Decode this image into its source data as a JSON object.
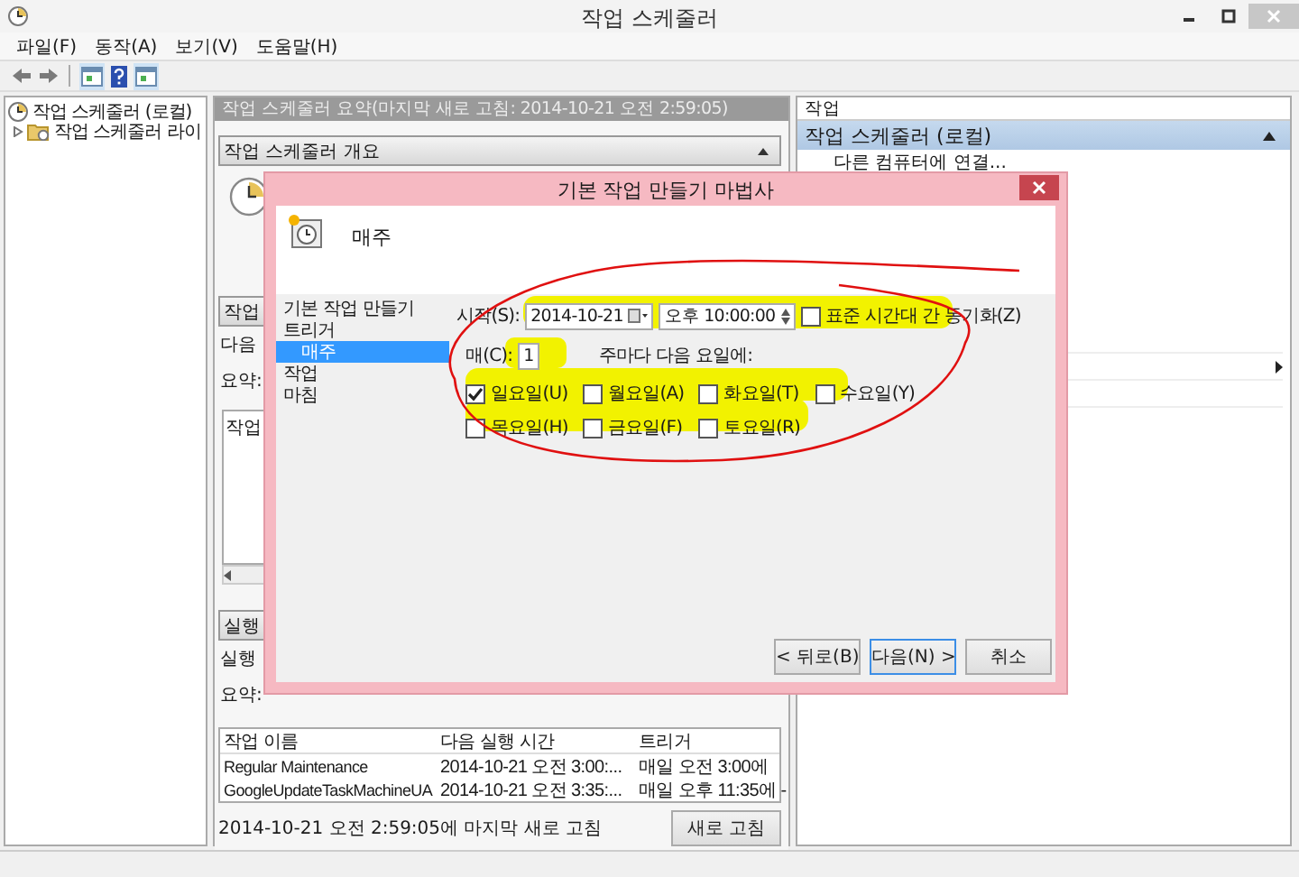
{
  "window": {
    "title": "작업 스케줄러"
  },
  "menu": [
    "파일(F)",
    "동작(A)",
    "보기(V)",
    "도움말(H)"
  ],
  "tree": [
    {
      "label": "작업 스케줄러 (로컬)",
      "children": [
        {
          "label": "작업 스케줄러 라이",
          "expanded": false
        }
      ]
    }
  ],
  "summary": {
    "header": "작업 스케줄러 요약(마지막 새로 고침: 2014-10-21 오전 2:59:05)",
    "overview": {
      "title": "작업 스케줄러 개요",
      "expanded": true
    },
    "status_section": {
      "title": "작업",
      "lines": [
        "다음",
        "요약:"
      ],
      "list_header": "작업"
    },
    "running_section": {
      "title": "실행",
      "lines": [
        "실행",
        "요약:"
      ]
    },
    "table": {
      "columns": [
        "작업 이름",
        "다음 실행 시간",
        "트리거"
      ],
      "rows": [
        [
          "Regular Maintenance",
          "2014-10-21 오전 3:00:...",
          "매일 오전 3:00에"
        ],
        [
          "GoogleUpdateTaskMachineUA",
          "2014-10-21 오전 3:35:...",
          "매일 오후 11:35에 -"
        ]
      ]
    },
    "refreshed": "2014-10-21 오전 2:59:05에 마지막 새로 고침",
    "refresh_button": "새로 고침"
  },
  "actions": {
    "header": "작업",
    "group": {
      "title": "작업 스케줄러 (로컬)",
      "expanded": true,
      "items": [
        "다른 컴퓨터에 연결..."
      ]
    }
  },
  "dialog": {
    "title": "기본 작업 만들기 마법사",
    "step_title": "매주",
    "steps": [
      {
        "label": "기본 작업 만들기",
        "selected": false
      },
      {
        "label": "트리거",
        "selected": false,
        "children": [
          {
            "label": "매주",
            "selected": true
          }
        ]
      },
      {
        "label": "작업",
        "selected": false
      },
      {
        "label": "마침",
        "selected": false
      }
    ],
    "start_label": "시작(S):",
    "date": "2014-10-21",
    "time": "오후 10:00:00",
    "sync": {
      "label": "표준 시간대 간 동기화(Z)",
      "checked": false
    },
    "recur_label": "매(C):",
    "recur_value": "1",
    "weeks_label": "주마다 다음 요일에:",
    "days": [
      {
        "label": "일요일(U)",
        "checked": true
      },
      {
        "label": "월요일(A)",
        "checked": false
      },
      {
        "label": "화요일(T)",
        "checked": false
      },
      {
        "label": "수요일(Y)",
        "checked": false
      },
      {
        "label": "목요일(H)",
        "checked": false
      },
      {
        "label": "금요일(F)",
        "checked": false
      },
      {
        "label": "토요일(R)",
        "checked": false
      }
    ],
    "buttons": [
      {
        "label": "< 뒤로(B)",
        "default": false
      },
      {
        "label": "다음(N) >",
        "default": true
      },
      {
        "label": "취소",
        "default": false
      }
    ]
  }
}
